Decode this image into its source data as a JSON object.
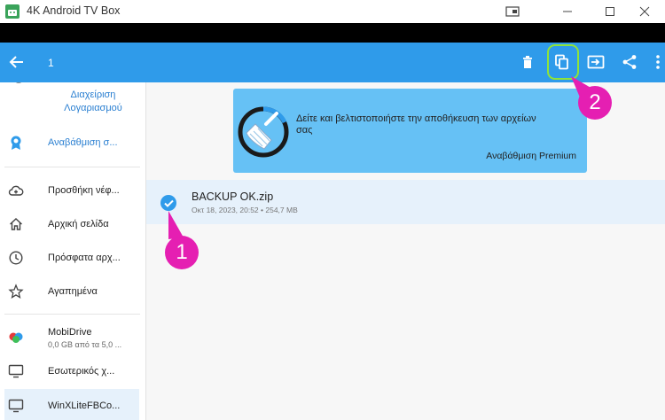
{
  "window": {
    "title": "4K Android TV Box"
  },
  "appbar": {
    "selection_count": "1",
    "icons": [
      "arrow-back-icon",
      "delete-icon",
      "copy-icon",
      "move-icon",
      "share-icon",
      "more-vert-icon"
    ]
  },
  "sidebar": {
    "account_line1": "Διαχείριση",
    "account_line2": "Λογαριασμού",
    "items": [
      {
        "label": "Αναβάθμιση σ...",
        "icon": "premium-badge-icon",
        "accent": true
      },
      {
        "label": "Προσθήκη νέφ...",
        "icon": "cloud-add-icon"
      },
      {
        "label": "Αρχική σελίδα",
        "icon": "home-icon"
      },
      {
        "label": "Πρόσφατα αρχ...",
        "icon": "clock-icon"
      },
      {
        "label": "Αγαπημένα",
        "icon": "star-icon"
      },
      {
        "label": "MobiDrive",
        "sub": "0,0 GB από τα 5,0 ...",
        "icon": "mobidrive-icon"
      },
      {
        "label": "Εσωτερικός χ...",
        "icon": "monitor-icon"
      },
      {
        "label": "WinXLiteFBCo...",
        "icon": "usb-drive-icon",
        "selected": true
      }
    ]
  },
  "banner": {
    "text": "Δείτε και βελτιστοποιήστε την αποθήκευση των αρχείων σας",
    "cta": "Αναβάθμιση Premium"
  },
  "file": {
    "name": "BACKUP OK.zip",
    "meta": "Οκτ 18, 2023, 20:52 • 254,7 MB",
    "selected": true
  },
  "annotations": {
    "badge1": "1",
    "badge2": "2"
  },
  "colors": {
    "accent": "#2f9bea",
    "banner": "#66c1f5",
    "badge": "#e51fb2",
    "highlight_ring": "#8ee33a"
  }
}
